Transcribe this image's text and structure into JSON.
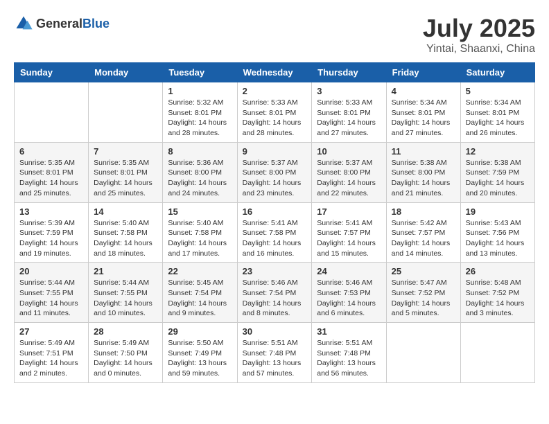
{
  "logo": {
    "general": "General",
    "blue": "Blue"
  },
  "header": {
    "month": "July 2025",
    "location": "Yintai, Shaanxi, China"
  },
  "weekdays": [
    "Sunday",
    "Monday",
    "Tuesday",
    "Wednesday",
    "Thursday",
    "Friday",
    "Saturday"
  ],
  "weeks": [
    [
      {
        "day": "",
        "sunrise": "",
        "sunset": "",
        "daylight": ""
      },
      {
        "day": "",
        "sunrise": "",
        "sunset": "",
        "daylight": ""
      },
      {
        "day": "1",
        "sunrise": "Sunrise: 5:32 AM",
        "sunset": "Sunset: 8:01 PM",
        "daylight": "Daylight: 14 hours and 28 minutes."
      },
      {
        "day": "2",
        "sunrise": "Sunrise: 5:33 AM",
        "sunset": "Sunset: 8:01 PM",
        "daylight": "Daylight: 14 hours and 28 minutes."
      },
      {
        "day": "3",
        "sunrise": "Sunrise: 5:33 AM",
        "sunset": "Sunset: 8:01 PM",
        "daylight": "Daylight: 14 hours and 27 minutes."
      },
      {
        "day": "4",
        "sunrise": "Sunrise: 5:34 AM",
        "sunset": "Sunset: 8:01 PM",
        "daylight": "Daylight: 14 hours and 27 minutes."
      },
      {
        "day": "5",
        "sunrise": "Sunrise: 5:34 AM",
        "sunset": "Sunset: 8:01 PM",
        "daylight": "Daylight: 14 hours and 26 minutes."
      }
    ],
    [
      {
        "day": "6",
        "sunrise": "Sunrise: 5:35 AM",
        "sunset": "Sunset: 8:01 PM",
        "daylight": "Daylight: 14 hours and 25 minutes."
      },
      {
        "day": "7",
        "sunrise": "Sunrise: 5:35 AM",
        "sunset": "Sunset: 8:01 PM",
        "daylight": "Daylight: 14 hours and 25 minutes."
      },
      {
        "day": "8",
        "sunrise": "Sunrise: 5:36 AM",
        "sunset": "Sunset: 8:00 PM",
        "daylight": "Daylight: 14 hours and 24 minutes."
      },
      {
        "day": "9",
        "sunrise": "Sunrise: 5:37 AM",
        "sunset": "Sunset: 8:00 PM",
        "daylight": "Daylight: 14 hours and 23 minutes."
      },
      {
        "day": "10",
        "sunrise": "Sunrise: 5:37 AM",
        "sunset": "Sunset: 8:00 PM",
        "daylight": "Daylight: 14 hours and 22 minutes."
      },
      {
        "day": "11",
        "sunrise": "Sunrise: 5:38 AM",
        "sunset": "Sunset: 8:00 PM",
        "daylight": "Daylight: 14 hours and 21 minutes."
      },
      {
        "day": "12",
        "sunrise": "Sunrise: 5:38 AM",
        "sunset": "Sunset: 7:59 PM",
        "daylight": "Daylight: 14 hours and 20 minutes."
      }
    ],
    [
      {
        "day": "13",
        "sunrise": "Sunrise: 5:39 AM",
        "sunset": "Sunset: 7:59 PM",
        "daylight": "Daylight: 14 hours and 19 minutes."
      },
      {
        "day": "14",
        "sunrise": "Sunrise: 5:40 AM",
        "sunset": "Sunset: 7:58 PM",
        "daylight": "Daylight: 14 hours and 18 minutes."
      },
      {
        "day": "15",
        "sunrise": "Sunrise: 5:40 AM",
        "sunset": "Sunset: 7:58 PM",
        "daylight": "Daylight: 14 hours and 17 minutes."
      },
      {
        "day": "16",
        "sunrise": "Sunrise: 5:41 AM",
        "sunset": "Sunset: 7:58 PM",
        "daylight": "Daylight: 14 hours and 16 minutes."
      },
      {
        "day": "17",
        "sunrise": "Sunrise: 5:41 AM",
        "sunset": "Sunset: 7:57 PM",
        "daylight": "Daylight: 14 hours and 15 minutes."
      },
      {
        "day": "18",
        "sunrise": "Sunrise: 5:42 AM",
        "sunset": "Sunset: 7:57 PM",
        "daylight": "Daylight: 14 hours and 14 minutes."
      },
      {
        "day": "19",
        "sunrise": "Sunrise: 5:43 AM",
        "sunset": "Sunset: 7:56 PM",
        "daylight": "Daylight: 14 hours and 13 minutes."
      }
    ],
    [
      {
        "day": "20",
        "sunrise": "Sunrise: 5:44 AM",
        "sunset": "Sunset: 7:55 PM",
        "daylight": "Daylight: 14 hours and 11 minutes."
      },
      {
        "day": "21",
        "sunrise": "Sunrise: 5:44 AM",
        "sunset": "Sunset: 7:55 PM",
        "daylight": "Daylight: 14 hours and 10 minutes."
      },
      {
        "day": "22",
        "sunrise": "Sunrise: 5:45 AM",
        "sunset": "Sunset: 7:54 PM",
        "daylight": "Daylight: 14 hours and 9 minutes."
      },
      {
        "day": "23",
        "sunrise": "Sunrise: 5:46 AM",
        "sunset": "Sunset: 7:54 PM",
        "daylight": "Daylight: 14 hours and 8 minutes."
      },
      {
        "day": "24",
        "sunrise": "Sunrise: 5:46 AM",
        "sunset": "Sunset: 7:53 PM",
        "daylight": "Daylight: 14 hours and 6 minutes."
      },
      {
        "day": "25",
        "sunrise": "Sunrise: 5:47 AM",
        "sunset": "Sunset: 7:52 PM",
        "daylight": "Daylight: 14 hours and 5 minutes."
      },
      {
        "day": "26",
        "sunrise": "Sunrise: 5:48 AM",
        "sunset": "Sunset: 7:52 PM",
        "daylight": "Daylight: 14 hours and 3 minutes."
      }
    ],
    [
      {
        "day": "27",
        "sunrise": "Sunrise: 5:49 AM",
        "sunset": "Sunset: 7:51 PM",
        "daylight": "Daylight: 14 hours and 2 minutes."
      },
      {
        "day": "28",
        "sunrise": "Sunrise: 5:49 AM",
        "sunset": "Sunset: 7:50 PM",
        "daylight": "Daylight: 14 hours and 0 minutes."
      },
      {
        "day": "29",
        "sunrise": "Sunrise: 5:50 AM",
        "sunset": "Sunset: 7:49 PM",
        "daylight": "Daylight: 13 hours and 59 minutes."
      },
      {
        "day": "30",
        "sunrise": "Sunrise: 5:51 AM",
        "sunset": "Sunset: 7:48 PM",
        "daylight": "Daylight: 13 hours and 57 minutes."
      },
      {
        "day": "31",
        "sunrise": "Sunrise: 5:51 AM",
        "sunset": "Sunset: 7:48 PM",
        "daylight": "Daylight: 13 hours and 56 minutes."
      },
      {
        "day": "",
        "sunrise": "",
        "sunset": "",
        "daylight": ""
      },
      {
        "day": "",
        "sunrise": "",
        "sunset": "",
        "daylight": ""
      }
    ]
  ]
}
